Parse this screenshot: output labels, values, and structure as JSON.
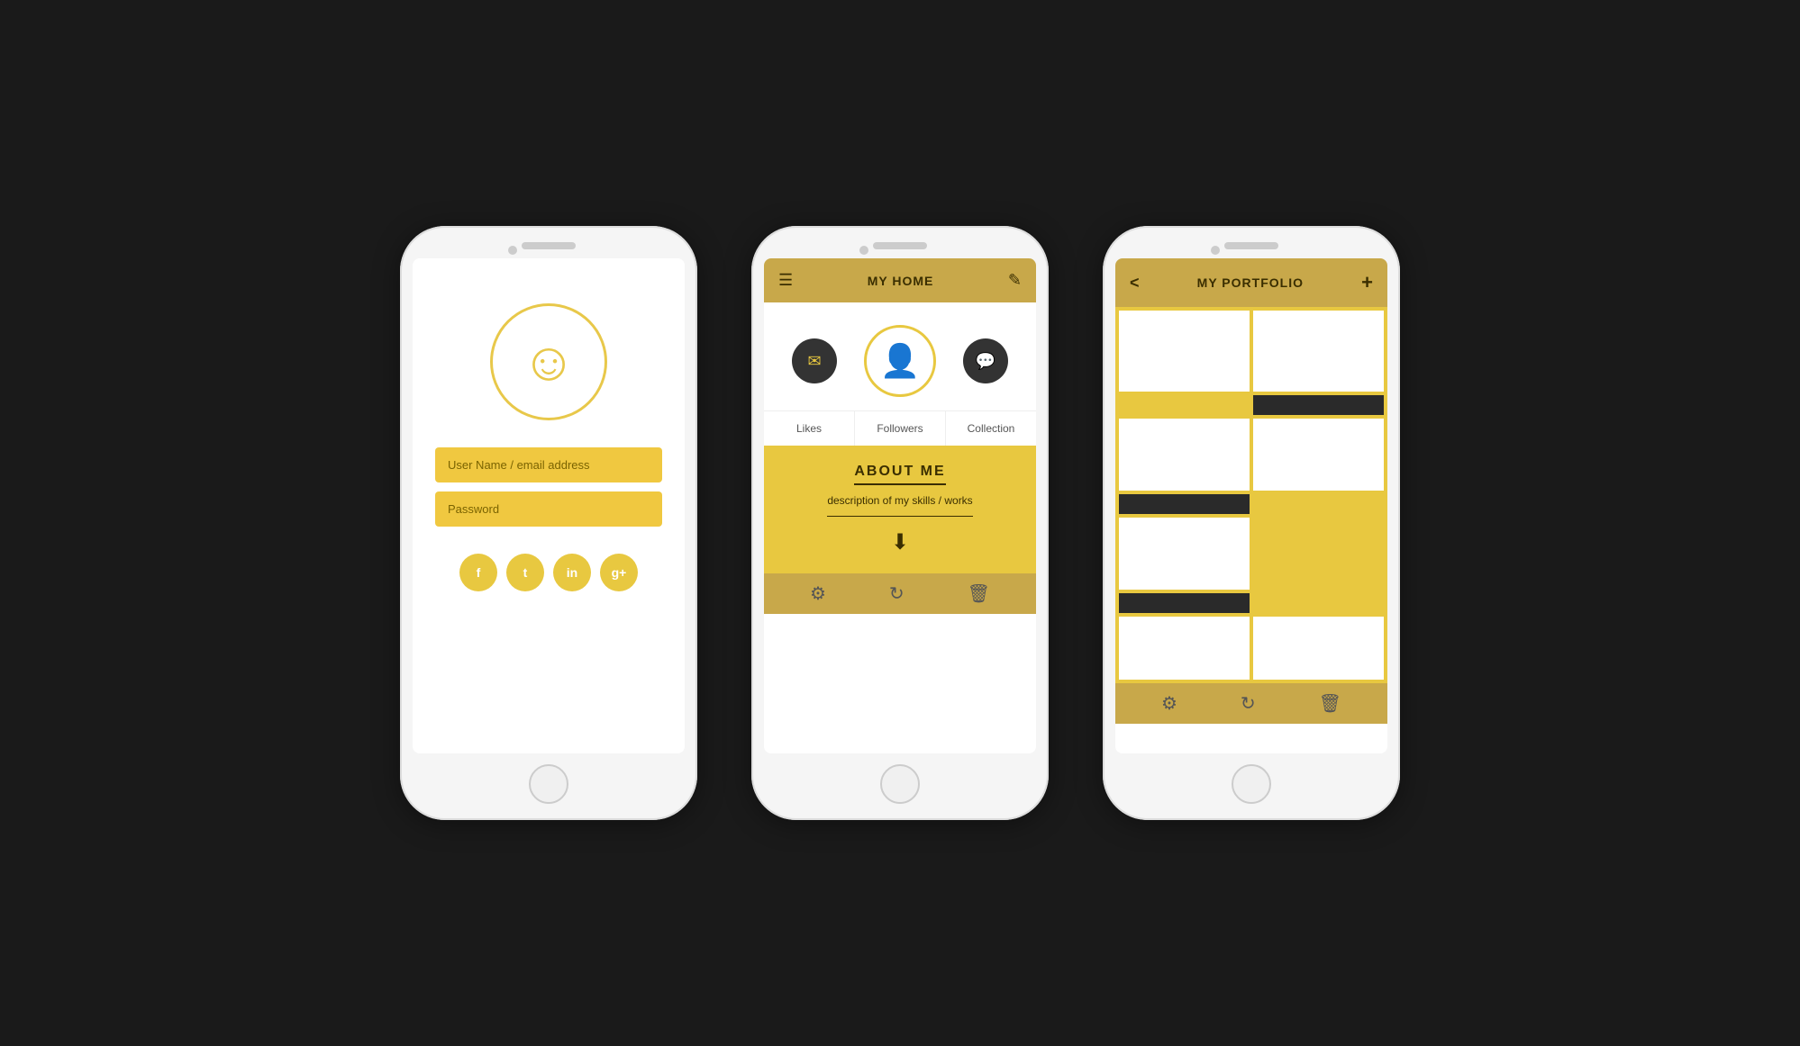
{
  "phone1": {
    "username_placeholder": "User Name / email address",
    "password_placeholder": "Password",
    "social": [
      "f",
      "t",
      "in",
      "g+"
    ]
  },
  "phone2": {
    "header": {
      "title": "MY HOME",
      "menu_icon": "☰",
      "edit_icon": "✎"
    },
    "tabs": [
      "Likes",
      "Followers",
      "Collection"
    ],
    "about": {
      "title": "ABOUT ME",
      "description": "description of my skills / works"
    },
    "footer_icons": [
      "⚙",
      "↺",
      "🗑"
    ]
  },
  "phone3": {
    "header": {
      "title": "MY PORTFOLIO",
      "back_icon": "<",
      "add_icon": "+"
    },
    "footer_icons": [
      "⚙",
      "↺",
      "🗑"
    ]
  },
  "colors": {
    "gold": "#e8c840",
    "gold_header": "#c8a84a",
    "dark": "#333333",
    "text_dark": "#3a2e00"
  }
}
